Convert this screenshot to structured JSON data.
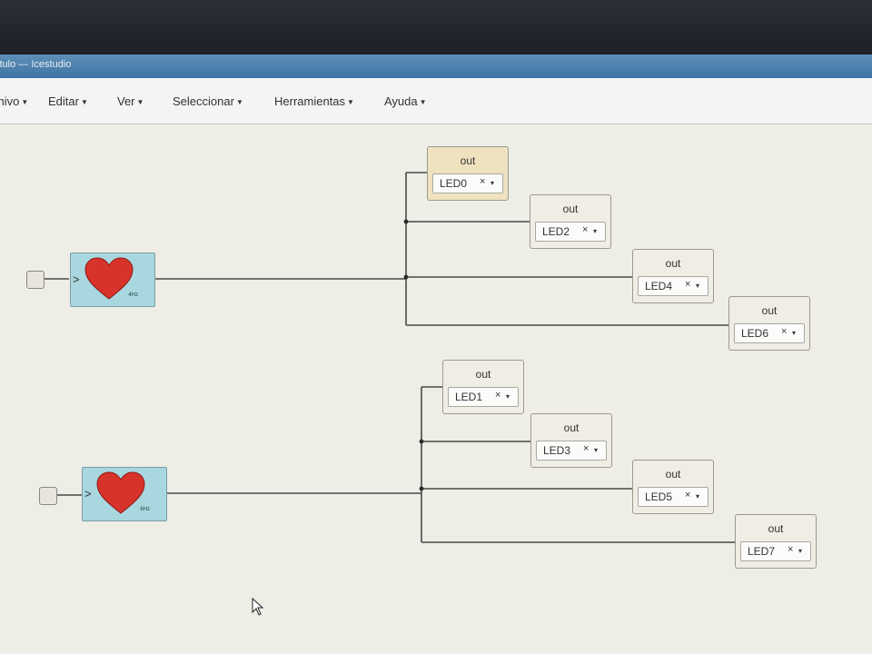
{
  "window": {
    "title": "titulo — Icestudio"
  },
  "menu": [
    {
      "label": "Archivo"
    },
    {
      "label": "Editar"
    },
    {
      "label": "Ver"
    },
    {
      "label": "Seleccionar"
    },
    {
      "label": "Herramientas"
    },
    {
      "label": "Ayuda"
    }
  ],
  "heartbeat": [
    {
      "freq": "4Hz"
    },
    {
      "freq": "6Hz"
    }
  ],
  "outputs": [
    {
      "label": "out",
      "value": "LED0",
      "clear_glyph": "×",
      "dropdown_glyph": "▾"
    },
    {
      "label": "out",
      "value": "LED2",
      "clear_glyph": "×",
      "dropdown_glyph": "▾"
    },
    {
      "label": "out",
      "value": "LED4",
      "clear_glyph": "×",
      "dropdown_glyph": "▾"
    },
    {
      "label": "out",
      "value": "LED6",
      "clear_glyph": "×",
      "dropdown_glyph": "▾"
    },
    {
      "label": "out",
      "value": "LED1",
      "clear_glyph": "×",
      "dropdown_glyph": "▾"
    },
    {
      "label": "out",
      "value": "LED3",
      "clear_glyph": "×",
      "dropdown_glyph": "▾"
    },
    {
      "label": "out",
      "value": "LED5",
      "clear_glyph": "×",
      "dropdown_glyph": "▾"
    },
    {
      "label": "out",
      "value": "LED7",
      "clear_glyph": "×",
      "dropdown_glyph": "▾"
    }
  ],
  "colors": {
    "heart": "#d8332b",
    "block": "#a9d7df",
    "wire": "#4a4a4a"
  }
}
